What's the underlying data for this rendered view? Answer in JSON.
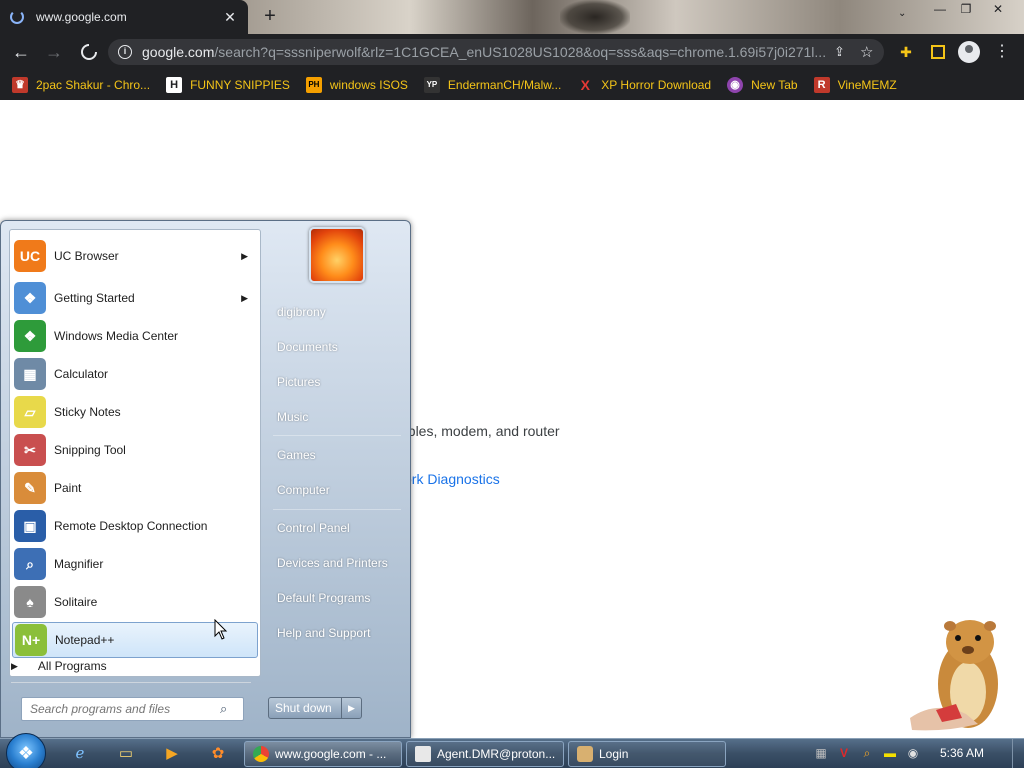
{
  "browser": {
    "tab_title": "www.google.com",
    "tab_close": "✕",
    "new_tab": "+",
    "url_domain": "google.com",
    "url_path": "/search?q=sssniperwolf&rlz=1C1GCEA_enUS1028US1028&oq=sss&aqs=chrome.1.69i57j0i271l...",
    "bookmarks": [
      {
        "label": "2pac Shakur - Chro...",
        "icon": "tupac-icon",
        "icon_text": "♛",
        "icon_bg": "#c0392b"
      },
      {
        "label": "FUNNY SNIPPIES",
        "icon": "h-icon",
        "icon_text": "H",
        "icon_bg": "#ffffff"
      },
      {
        "label": "windows ISOS",
        "icon": "ph-icon",
        "icon_text": "PH",
        "icon_bg": "#f5a000"
      },
      {
        "label": "EndermanCH/Malw...",
        "icon": "yp-icon",
        "icon_text": "YP",
        "icon_bg": "#333333"
      },
      {
        "label": "XP Horror Download",
        "icon": "x-icon",
        "icon_text": "X",
        "icon_bg": "#202124"
      },
      {
        "label": "New Tab",
        "icon": "newtab-icon",
        "icon_text": "◉",
        "icon_bg": "#8e44ad"
      },
      {
        "label": "VineMEMZ",
        "icon": "r-icon",
        "icon_text": "R",
        "icon_bg": "#c0392b"
      }
    ]
  },
  "page": {
    "text_partial": "ables, modem, and router",
    "link_partial": "ork Diagnostics"
  },
  "start_menu": {
    "programs": [
      {
        "label": "UC Browser",
        "arrow": true,
        "name": "uc-browser",
        "icon_bg": "#f07a1a",
        "icon_text": "UC"
      },
      {
        "label": "Getting Started",
        "arrow": true,
        "name": "getting-started",
        "icon_bg": "#4f8fd6",
        "icon_text": "❖"
      },
      {
        "label": "Windows Media Center",
        "arrow": false,
        "name": "windows-media-center",
        "icon_bg": "#2e9b3a",
        "icon_text": "❖"
      },
      {
        "label": "Calculator",
        "arrow": false,
        "name": "calculator",
        "icon_bg": "#6f8aa6",
        "icon_text": "▦"
      },
      {
        "label": "Sticky Notes",
        "arrow": false,
        "name": "sticky-notes",
        "icon_bg": "#e8d94a",
        "icon_text": "▱"
      },
      {
        "label": "Snipping Tool",
        "arrow": false,
        "name": "snipping-tool",
        "icon_bg": "#c94f4f",
        "icon_text": "✂"
      },
      {
        "label": "Paint",
        "arrow": false,
        "name": "paint",
        "icon_bg": "#d98c3a",
        "icon_text": "✎"
      },
      {
        "label": "Remote Desktop Connection",
        "arrow": false,
        "name": "remote-desktop-connection",
        "icon_bg": "#2a5ea8",
        "icon_text": "▣"
      },
      {
        "label": "Magnifier",
        "arrow": false,
        "name": "magnifier",
        "icon_bg": "#3d6fb5",
        "icon_text": "⌕"
      },
      {
        "label": "Solitaire",
        "arrow": false,
        "name": "solitaire",
        "icon_bg": "#8a8a8a",
        "icon_text": "♠"
      },
      {
        "label": "Notepad++",
        "arrow": false,
        "name": "notepad-plus-plus",
        "icon_bg": "#8bbf3a",
        "icon_text": "N+"
      }
    ],
    "highlighted_index": 10,
    "all_programs": "All Programs",
    "search_placeholder": "Search programs and files",
    "right_links": [
      "digibrony",
      "Documents",
      "Pictures",
      "Music",
      "Games",
      "Computer",
      "Control Panel",
      "Devices and Printers",
      "Default Programs",
      "Help and Support"
    ],
    "shutdown_label": "Shut down"
  },
  "taskbar": {
    "tasks": [
      {
        "label": "www.google.com - ...",
        "icon_bg": "#e8463a"
      },
      {
        "label": "Agent.DMR@proton...",
        "icon_bg": "#e8e8e8"
      },
      {
        "label": "Login",
        "icon_bg": "#d8b070"
      }
    ],
    "clock": "5:36 AM"
  }
}
